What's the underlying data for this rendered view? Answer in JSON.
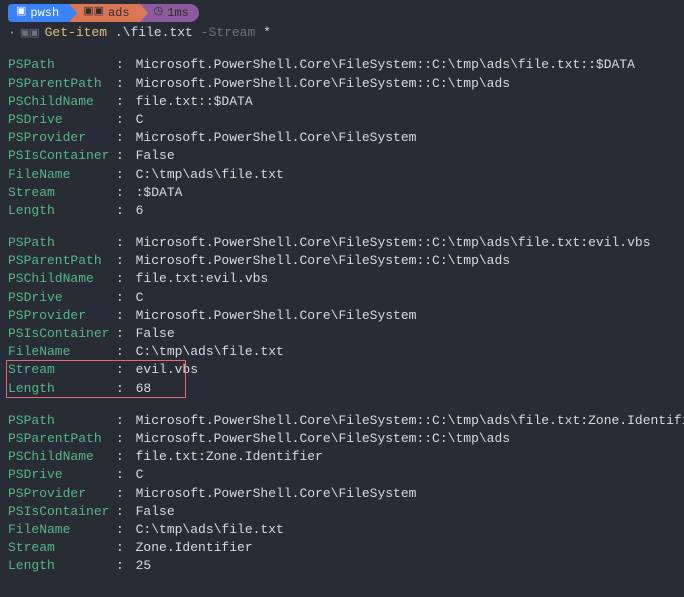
{
  "pills": {
    "shell": "pwsh",
    "dir": "ads",
    "time": "1ms"
  },
  "command": {
    "cmdlet": "Get-item",
    "arg": ".\\file.txt",
    "param": "-Stream",
    "glob": "*"
  },
  "blocks": [
    {
      "rows": [
        {
          "k": "PSPath",
          "v": "Microsoft.PowerShell.Core\\FileSystem::C:\\tmp\\ads\\file.txt::$DATA"
        },
        {
          "k": "PSParentPath",
          "v": "Microsoft.PowerShell.Core\\FileSystem::C:\\tmp\\ads"
        },
        {
          "k": "PSChildName",
          "v": "file.txt::$DATA"
        },
        {
          "k": "PSDrive",
          "v": "C"
        },
        {
          "k": "PSProvider",
          "v": "Microsoft.PowerShell.Core\\FileSystem"
        },
        {
          "k": "PSIsContainer",
          "v": "False"
        },
        {
          "k": "FileName",
          "v": "C:\\tmp\\ads\\file.txt"
        },
        {
          "k": "Stream",
          "v": ":$DATA"
        },
        {
          "k": "Length",
          "v": "6"
        }
      ],
      "highlight": null
    },
    {
      "rows": [
        {
          "k": "PSPath",
          "v": "Microsoft.PowerShell.Core\\FileSystem::C:\\tmp\\ads\\file.txt:evil.vbs"
        },
        {
          "k": "PSParentPath",
          "v": "Microsoft.PowerShell.Core\\FileSystem::C:\\tmp\\ads"
        },
        {
          "k": "PSChildName",
          "v": "file.txt:evil.vbs"
        },
        {
          "k": "PSDrive",
          "v": "C"
        },
        {
          "k": "PSProvider",
          "v": "Microsoft.PowerShell.Core\\FileSystem"
        },
        {
          "k": "PSIsContainer",
          "v": "False"
        },
        {
          "k": "FileName",
          "v": "C:\\tmp\\ads\\file.txt"
        },
        {
          "k": "Stream",
          "v": "evil.vbs"
        },
        {
          "k": "Length",
          "v": "68"
        }
      ],
      "highlight": {
        "startRow": 7,
        "endRow": 8
      }
    },
    {
      "rows": [
        {
          "k": "PSPath",
          "v": "Microsoft.PowerShell.Core\\FileSystem::C:\\tmp\\ads\\file.txt:Zone.Identifier"
        },
        {
          "k": "PSParentPath",
          "v": "Microsoft.PowerShell.Core\\FileSystem::C:\\tmp\\ads"
        },
        {
          "k": "PSChildName",
          "v": "file.txt:Zone.Identifier"
        },
        {
          "k": "PSDrive",
          "v": "C"
        },
        {
          "k": "PSProvider",
          "v": "Microsoft.PowerShell.Core\\FileSystem"
        },
        {
          "k": "PSIsContainer",
          "v": "False"
        },
        {
          "k": "FileName",
          "v": "C:\\tmp\\ads\\file.txt"
        },
        {
          "k": "Stream",
          "v": "Zone.Identifier"
        },
        {
          "k": "Length",
          "v": "25"
        }
      ],
      "highlight": null
    }
  ]
}
